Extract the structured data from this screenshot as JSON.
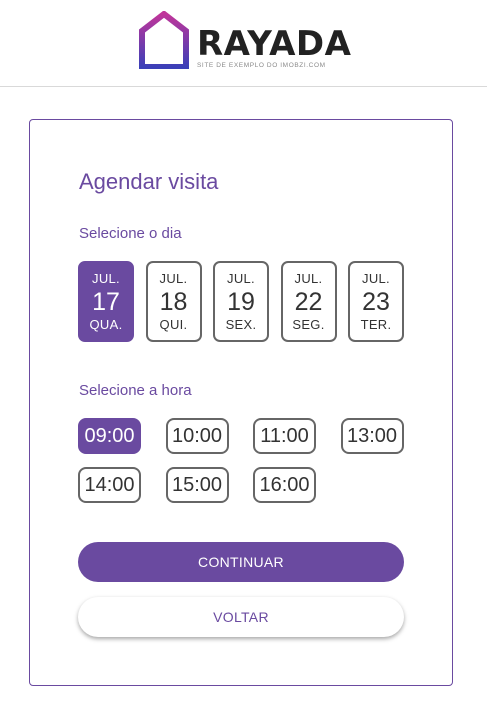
{
  "brand": {
    "name": "RAYADA",
    "tagline": "SITE DE EXEMPLO DO IMOBZI.COM",
    "logo_icon": "house-logo-icon",
    "gradient": [
      "#c0359a",
      "#3b3fb8"
    ]
  },
  "colors": {
    "accent": "#6a4aa0",
    "border": "#666666"
  },
  "schedule": {
    "title": "Agendar visita",
    "day_label": "Selecione o dia",
    "hour_label": "Selecione a hora",
    "days": [
      {
        "month": "JUL.",
        "day": "17",
        "weekday": "QUA.",
        "selected": true
      },
      {
        "month": "JUL.",
        "day": "18",
        "weekday": "QUI.",
        "selected": false
      },
      {
        "month": "JUL.",
        "day": "19",
        "weekday": "SEX.",
        "selected": false
      },
      {
        "month": "JUL.",
        "day": "22",
        "weekday": "SEG.",
        "selected": false
      },
      {
        "month": "JUL.",
        "day": "23",
        "weekday": "TER.",
        "selected": false
      }
    ],
    "hours": [
      {
        "time": "09:00",
        "selected": true
      },
      {
        "time": "10:00",
        "selected": false
      },
      {
        "time": "11:00",
        "selected": false
      },
      {
        "time": "13:00",
        "selected": false
      },
      {
        "time": "14:00",
        "selected": false
      },
      {
        "time": "15:00",
        "selected": false
      },
      {
        "time": "16:00",
        "selected": false
      }
    ],
    "continue_label": "CONTINUAR",
    "back_label": "VOLTAR"
  }
}
